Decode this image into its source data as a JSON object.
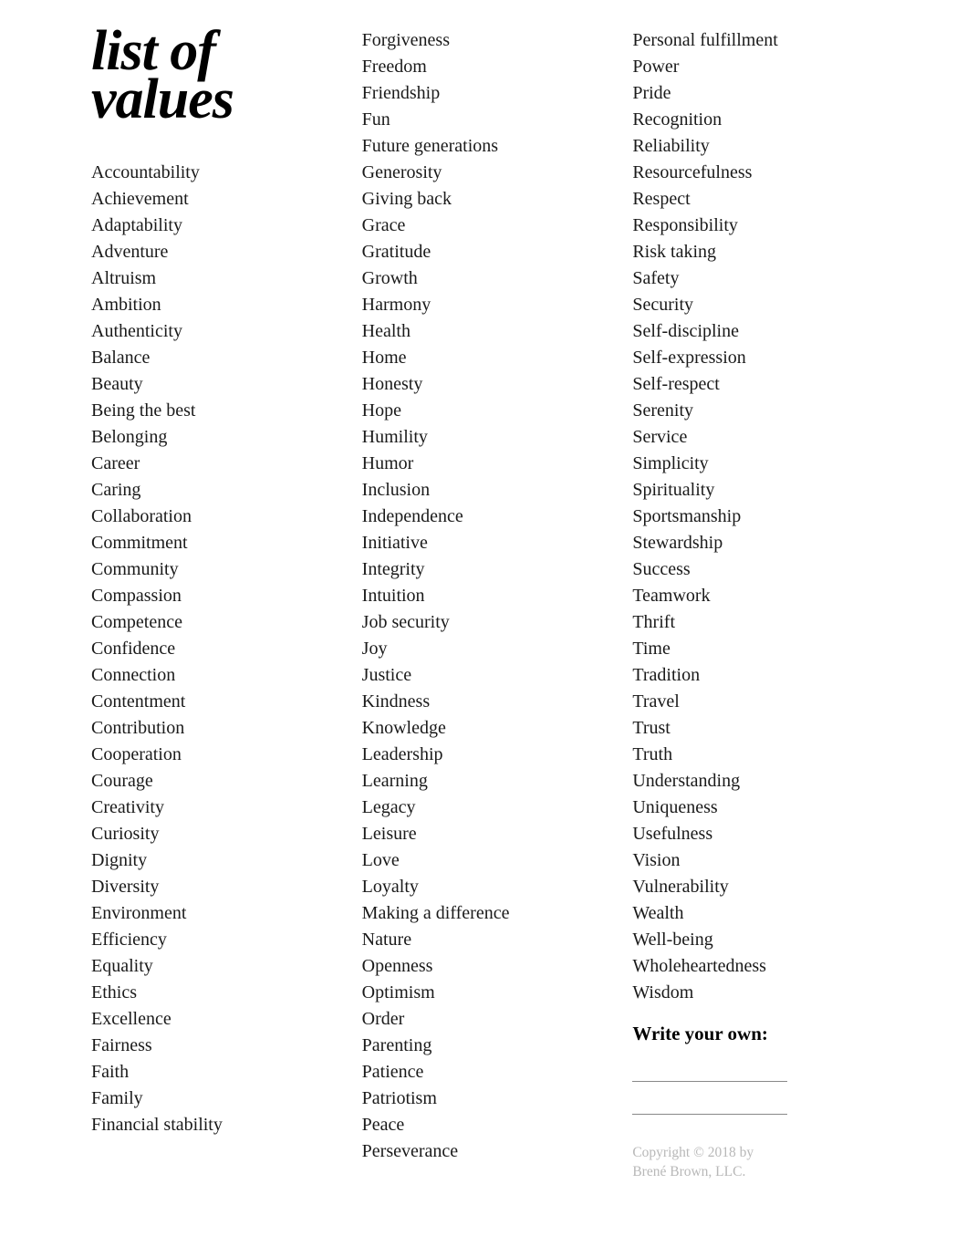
{
  "title_line1": "list of",
  "title_line2": "values",
  "columns": {
    "col1": [
      "Accountability",
      "Achievement",
      "Adaptability",
      "Adventure",
      "Altruism",
      "Ambition",
      "Authenticity",
      "Balance",
      "Beauty",
      "Being the best",
      "Belonging",
      "Career",
      "Caring",
      "Collaboration",
      "Commitment",
      "Community",
      "Compassion",
      "Competence",
      "Confidence",
      "Connection",
      "Contentment",
      "Contribution",
      "Cooperation",
      "Courage",
      "Creativity",
      "Curiosity",
      "Dignity",
      "Diversity",
      "Environment",
      "Efficiency",
      "Equality",
      "Ethics",
      "Excellence",
      "Fairness",
      "Faith",
      "Family",
      "Financial stability"
    ],
    "col2": [
      "Forgiveness",
      "Freedom",
      "Friendship",
      "Fun",
      "Future generations",
      "Generosity",
      "Giving back",
      "Grace",
      "Gratitude",
      "Growth",
      "Harmony",
      "Health",
      "Home",
      "Honesty",
      "Hope",
      "Humility",
      "Humor",
      "Inclusion",
      "Independence",
      "Initiative",
      "Integrity",
      "Intuition",
      "Job security",
      "Joy",
      "Justice",
      "Kindness",
      "Knowledge",
      "Leadership",
      "Learning",
      "Legacy",
      "Leisure",
      "Love",
      "Loyalty",
      "Making a difference",
      "Nature",
      "Openness",
      "Optimism",
      "Order",
      "Parenting",
      "Patience",
      "Patriotism",
      "Peace",
      "Perseverance"
    ],
    "col3": [
      "Personal fulfillment",
      "Power",
      "Pride",
      "Recognition",
      "Reliability",
      "Resourcefulness",
      "Respect",
      "Responsibility",
      "Risk taking",
      "Safety",
      "Security",
      "Self-discipline",
      "Self-expression",
      "Self-respect",
      "Serenity",
      "Service",
      "Simplicity",
      "Spirituality",
      "Sportsmanship",
      "Stewardship",
      "Success",
      "Teamwork",
      "Thrift",
      "Time",
      "Tradition",
      "Travel",
      "Trust",
      "Truth",
      "Understanding",
      "Uniqueness",
      "Usefulness",
      "Vision",
      "Vulnerability",
      "Wealth",
      "Well-being",
      "Wholeheartedness",
      "Wisdom"
    ]
  },
  "write_own_heading": "Write your own:",
  "copyright_line1": "Copyright © 2018 by",
  "copyright_line2": "Brené Brown, LLC."
}
